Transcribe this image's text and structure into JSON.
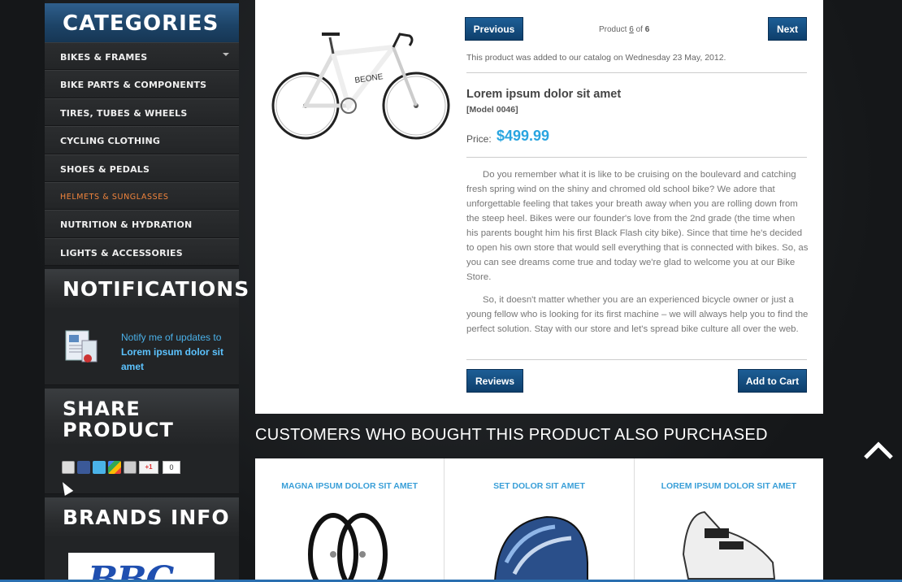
{
  "sidebar": {
    "categories_title": "CATEGORIES",
    "categories": [
      {
        "label": "BIKES & FRAMES"
      },
      {
        "label": "BIKE PARTS & COMPONENTS"
      },
      {
        "label": "TIRES, TUBES & WHEELS"
      },
      {
        "label": "CYCLING CLOTHING"
      },
      {
        "label": "SHOES & PEDALS"
      },
      {
        "label": "HELMETS & SUNGLASSES"
      },
      {
        "label": "NUTRITION & HYDRATION"
      },
      {
        "label": "LIGHTS & ACCESSORIES"
      }
    ],
    "notifications_title": "NOTIFICATIONS",
    "notify_text_1": "Notify me of updates to ",
    "notify_product": "Lorem ipsum dolor sit amet",
    "share_title_line1": "SHARE",
    "share_title_line2": "PRODUCT",
    "share_count": "0",
    "gplus_label": "+1",
    "brands_title": "BRANDS INFO",
    "brand_logo_text": "BBC"
  },
  "product": {
    "prev_label": "Previous",
    "next_label": "Next",
    "counter_prefix": "Product ",
    "counter_current": "6",
    "counter_of": " of ",
    "counter_total": "6",
    "added_text": "This product was added to our catalog on Wednesday 23 May, 2012.",
    "title": "Lorem ipsum dolor sit amet",
    "model": "[Model 0046]",
    "price_label": "Price:",
    "price_value": "$499.99",
    "desc_p1": "Do you remember what it is like to be cruising on the boulevard and catching fresh spring wind on the shiny and chromed old school bike? We adore that unforgettable feeling that takes your breath away when you are rolling down from the steep heel. Bikes were our founder's love from the 2nd grade (the time when his parents bought him his first Black Flash city bike). Since that time he's decided to open his own store that would sell everything that is connected with bikes. So, as you can see dreams come true and today we're glad to welcome you at our Bike Store.",
    "desc_p2": "So, it doesn't matter whether you are an experienced bicycle owner or just a young fellow who is looking for its first machine – we will always help you to find the perfect solution. Stay with our store and let's spread bike culture all over the web.",
    "reviews_label": "Reviews",
    "add_to_cart_label": "Add to Cart"
  },
  "also_purchased": {
    "title": "CUSTOMERS WHO BOUGHT THIS PRODUCT ALSO PURCHASED",
    "items": [
      {
        "name": "MAGNA IPSUM DOLOR SIT AMET",
        "icon": "wheels-image"
      },
      {
        "name": "SET DOLOR SIT AMET",
        "icon": "helmet-image"
      },
      {
        "name": "LOREM IPSUM DOLOR SIT AMET",
        "icon": "shoe-image"
      }
    ]
  },
  "colors": {
    "accent_blue": "#2aa5e0",
    "active_category": "#f0843c",
    "button_blue": "#0e3f6c"
  }
}
